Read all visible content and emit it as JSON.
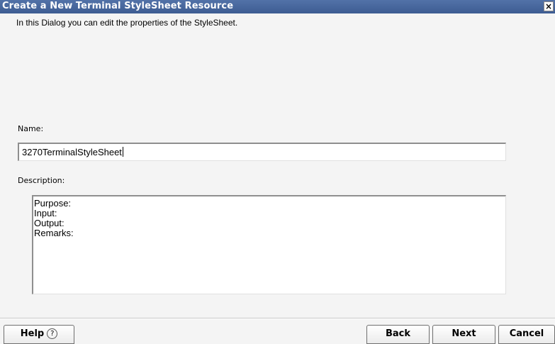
{
  "window": {
    "title": "Create a New Terminal StyleSheet Resource",
    "close_symbol": "×"
  },
  "intro_text": "In this Dialog you can edit the properties of the StyleSheet.",
  "form": {
    "name_label": "Name:",
    "name_value": "3270TerminalStyleSheet",
    "description_label": "Description:",
    "description_value": "Purpose:\nInput:\nOutput:\nRemarks:"
  },
  "buttons": {
    "help_label": "Help",
    "help_icon": "question-circle-icon",
    "help_glyph": "?",
    "back_label": "Back",
    "next_label": "Next",
    "cancel_label": "Cancel"
  },
  "colors": {
    "titlebar": "#4a6aa0",
    "title_text": "#ffffff"
  }
}
